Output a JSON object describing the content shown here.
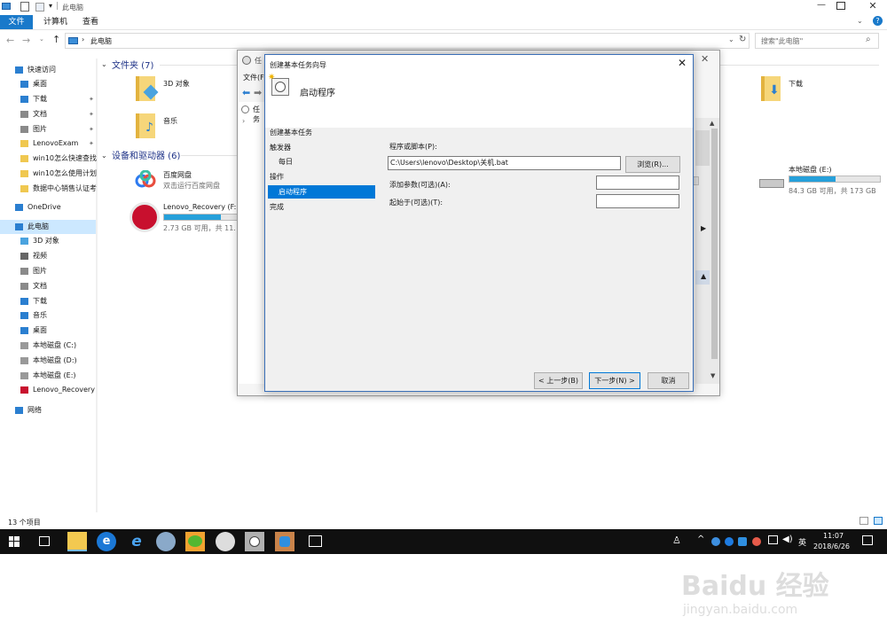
{
  "explorer": {
    "title": "此电脑",
    "ribbon_tabs": [
      "文件",
      "计算机",
      "查看"
    ],
    "address_path": "此电脑",
    "search_placeholder": "搜索\"此电脑\"",
    "status_count": "13 个项目",
    "sidebar": [
      {
        "label": "快速访问",
        "icon": "star-icon"
      },
      {
        "label": "桌面",
        "icon": "desktop-icon"
      },
      {
        "label": "下载",
        "icon": "download-icon"
      },
      {
        "label": "文档",
        "icon": "document-icon"
      },
      {
        "label": "图片",
        "icon": "pictures-icon"
      },
      {
        "label": "LenovoExam",
        "icon": "folder-icon"
      },
      {
        "label": "win10怎么快速查找",
        "icon": "folder-icon"
      },
      {
        "label": "win10怎么使用计划",
        "icon": "folder-icon"
      },
      {
        "label": "数据中心销售认证考",
        "icon": "folder-icon"
      },
      {
        "label": "OneDrive",
        "icon": "cloud-icon"
      },
      {
        "label": "此电脑",
        "icon": "computer-icon"
      },
      {
        "label": "3D 对象",
        "icon": "3d-objects-icon"
      },
      {
        "label": "视频",
        "icon": "video-icon"
      },
      {
        "label": "图片",
        "icon": "pictures-icon"
      },
      {
        "label": "文档",
        "icon": "document-icon"
      },
      {
        "label": "下载",
        "icon": "download-icon"
      },
      {
        "label": "音乐",
        "icon": "music-icon"
      },
      {
        "label": "桌面",
        "icon": "desktop-icon"
      },
      {
        "label": "本地磁盘 (C:)",
        "icon": "drive-icon"
      },
      {
        "label": "本地磁盘 (D:)",
        "icon": "drive-icon"
      },
      {
        "label": "本地磁盘 (E:)",
        "icon": "drive-icon"
      },
      {
        "label": "Lenovo_Recovery",
        "icon": "recovery-drive-icon"
      },
      {
        "label": "网络",
        "icon": "network-icon"
      }
    ],
    "folders_header": "文件夹 (7)",
    "folders": [
      "3D 对象",
      "音乐",
      "下载"
    ],
    "devices_header": "设备和驱动器 (6)",
    "devices": [
      {
        "name": "百度网盘",
        "sub": "双击运行百度网盘"
      },
      {
        "name": "Lenovo_Recovery (F:)",
        "sub": "2.73 GB 可用，共 11.",
        "fill": 0.76
      },
      {
        "name": "本地磁盘 (E:)",
        "sub": "84.3 GB 可用，共 173 GB",
        "fill": 0.51
      }
    ]
  },
  "bg_window": {
    "title_fragment": "任",
    "menu_fragment": "文件(F",
    "tree_fragment": "任务"
  },
  "dialog": {
    "title": "创建基本任务向导",
    "header": "启动程序",
    "steps_title": "创建基本任务",
    "steps": [
      "触发器",
      "每日",
      "操作",
      "启动程序",
      "完成"
    ],
    "program_label": "程序或脚本(P):",
    "program_value": "C:\\Users\\lenovo\\Desktop\\关机.bat",
    "browse": "浏览(R)...",
    "args_label": "添加参数(可选)(A):",
    "start_label": "起始于(可选)(T):",
    "back": "< 上一步(B)",
    "next": "下一步(N) >",
    "cancel": "取消"
  },
  "taskbar": {
    "time": "11:07",
    "date": "2018/6/26",
    "ime": "英"
  },
  "watermark": {
    "logo": "Baidu 经验",
    "url": "jingyan.baidu.com"
  },
  "colors": {
    "accent": "#0078d7",
    "selection": "#cce8ff",
    "dialog_select": "#0078d7",
    "taskbar": "#101010"
  }
}
